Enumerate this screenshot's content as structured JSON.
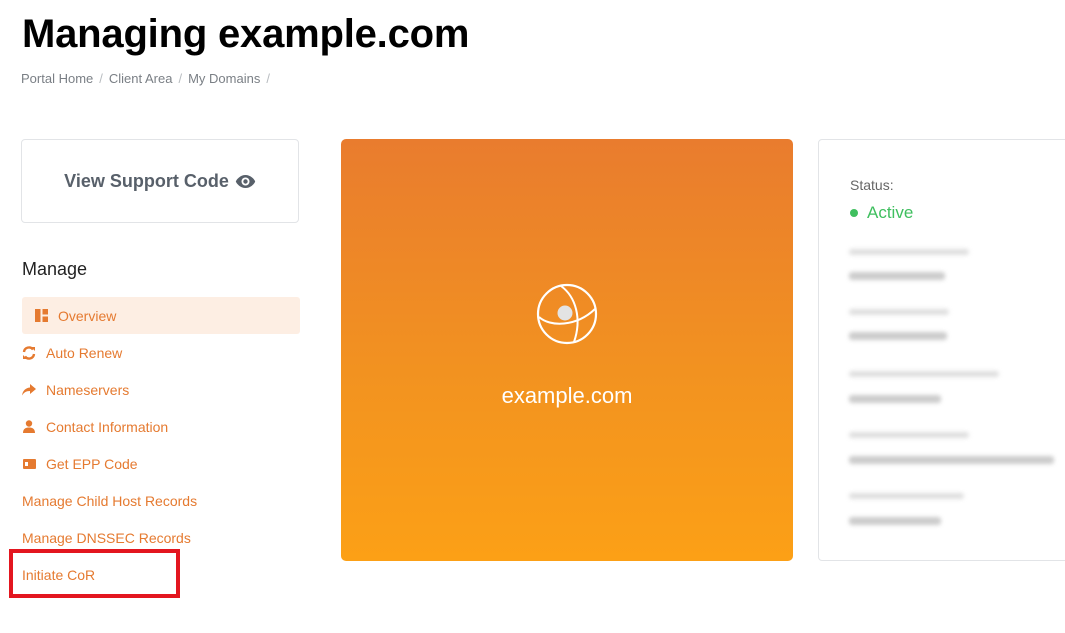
{
  "header": {
    "title": "Managing example.com",
    "breadcrumb": [
      "Portal Home",
      "Client Area",
      "My Domains"
    ]
  },
  "support": {
    "label": "View Support Code",
    "icon": "eye-icon"
  },
  "manage": {
    "heading": "Manage",
    "items": [
      {
        "label": "Overview",
        "icon": "dashboard-icon",
        "active": true
      },
      {
        "label": "Auto Renew",
        "icon": "refresh-icon"
      },
      {
        "label": "Nameservers",
        "icon": "share-arrow-icon"
      },
      {
        "label": "Contact Information",
        "icon": "user-icon"
      },
      {
        "label": "Get EPP Code",
        "icon": "id-card-icon"
      },
      {
        "label": "Manage Child Host Records"
      },
      {
        "label": "Manage DNSSEC Records"
      },
      {
        "label": "Initiate CoR"
      }
    ]
  },
  "domain": {
    "name": "example.com",
    "icon": "globe-icon"
  },
  "status": {
    "label": "Status:",
    "value": "Active"
  },
  "colors": {
    "accent": "#e57a30",
    "active_green": "#3fbf5f",
    "highlight_red": "#e3161f"
  }
}
